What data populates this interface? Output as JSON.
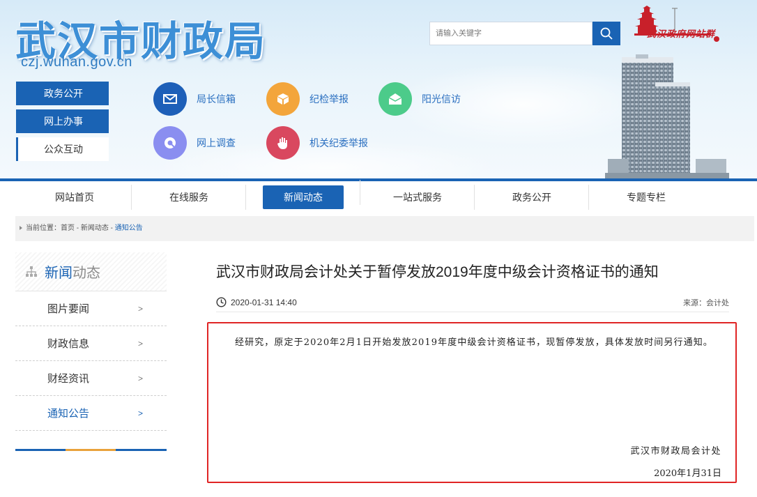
{
  "header": {
    "site_title": "武汉市财政局",
    "site_domain": "czj.wuhan.gov.cn",
    "search_placeholder": "请输入关键字",
    "gov_logo_text": "武汉政府网站群",
    "left_nav": [
      {
        "label": "政务公开"
      },
      {
        "label": "网上办事"
      },
      {
        "label": "公众互动"
      }
    ],
    "quick_links": [
      {
        "label": "局长信箱",
        "icon": "mail-icon",
        "color": "#1d5fb8"
      },
      {
        "label": "纪检举报",
        "icon": "box-icon",
        "color": "#f3a53b"
      },
      {
        "label": "阳光信访",
        "icon": "envelope-open-icon",
        "color": "#4ccb8a"
      },
      {
        "label": "网上调查",
        "icon": "survey-icon",
        "color": "#8a8ef0"
      },
      {
        "label": "机关纪委举报",
        "icon": "hand-icon",
        "color": "#d9485f"
      }
    ]
  },
  "main_nav": [
    {
      "label": "网站首页"
    },
    {
      "label": "在线服务"
    },
    {
      "label": "新闻动态"
    },
    {
      "label": "一站式服务"
    },
    {
      "label": "政务公开"
    },
    {
      "label": "专题专栏"
    }
  ],
  "breadcrumb": {
    "prefix": "当前位置：",
    "home": "首页",
    "sep": " - ",
    "section": "新闻动态",
    "current": "通知公告"
  },
  "sidebar": {
    "title_a": "新闻",
    "title_b": "动态",
    "items": [
      {
        "label": "图片要闻"
      },
      {
        "label": "财政信息"
      },
      {
        "label": "财经资讯"
      },
      {
        "label": "通知公告"
      }
    ],
    "chevron": ">"
  },
  "article": {
    "title": "武汉市财政局会计处关于暂停发放2019年度中级会计资格证书的通知",
    "datetime": "2020-01-31 14:40",
    "source": "来源：会计处",
    "body": "经研究，原定于2020年2月1日开始发放2019年度中级会计资格证书，现暂停发放，具体发放时间另行通知。",
    "signature": "武汉市财政局会计处",
    "sign_date": "2020年1月31日"
  },
  "colors": {
    "primary": "#1a63b4",
    "highlight_border": "#e02424",
    "accent": "#e9a23b"
  }
}
